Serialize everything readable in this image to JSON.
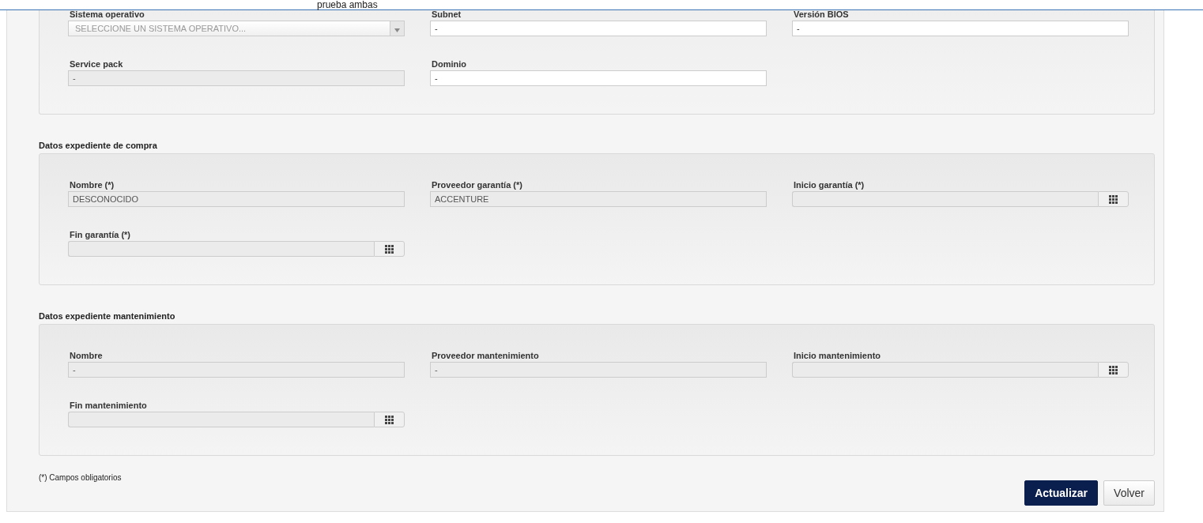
{
  "top_bar": {
    "title": "prueba ambas"
  },
  "sections": [
    {
      "fields": [
        {
          "label": "Sistema operativo",
          "kind": "select",
          "placeholder": "SELECCIONE UN SISTEMA OPERATIVO..."
        },
        {
          "label": "Subnet",
          "kind": "text",
          "value": "-"
        },
        {
          "label": "Versión BIOS",
          "kind": "text",
          "value": "-"
        },
        {
          "label": "Service pack",
          "kind": "readonly",
          "value": "-"
        },
        {
          "label": "Dominio",
          "kind": "text",
          "value": "-"
        }
      ]
    },
    {
      "heading": "Datos expediente de compra",
      "fields": [
        {
          "label": "Nombre (*)",
          "kind": "readonly",
          "value": "DESCONOCIDO"
        },
        {
          "label": "Proveedor garantía (*)",
          "kind": "readonly",
          "value": "ACCENTURE"
        },
        {
          "label": "Inicio garantía (*)",
          "kind": "date"
        },
        {
          "label": "Fin garantía (*)",
          "kind": "date"
        }
      ]
    },
    {
      "heading": "Datos expediente mantenimiento",
      "fields": [
        {
          "label": "Nombre",
          "kind": "readonly",
          "value": "-"
        },
        {
          "label": "Proveedor mantenimiento",
          "kind": "readonly",
          "value": "-"
        },
        {
          "label": "Inicio mantenimiento",
          "kind": "date"
        },
        {
          "label": "Fin mantenimiento",
          "kind": "date"
        }
      ]
    }
  ],
  "footnote": "(*) Campos obligatorios",
  "buttons": [
    {
      "label": "Actualizar",
      "kind": "primary"
    },
    {
      "label": "Volver",
      "kind": "secondary"
    }
  ]
}
